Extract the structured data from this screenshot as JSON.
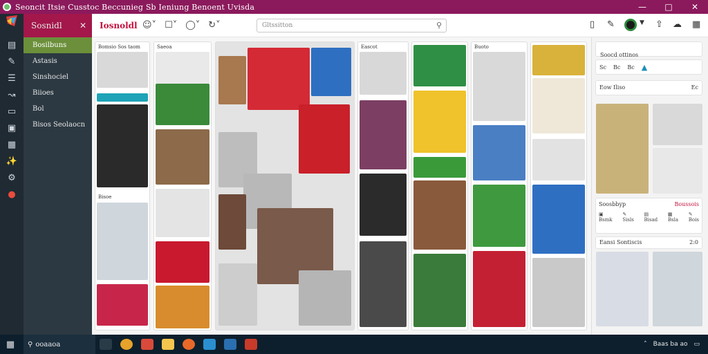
{
  "window": {
    "title": "Seoncit Itsie Cusstoc Beccunieg  Sb  Ieniung Benoent  Uvisda",
    "minimize_icon": "minimize-icon",
    "maximize_icon": "maximize-icon",
    "close_icon": "close-icon"
  },
  "sidebar": {
    "header_label": "Sosnidl",
    "items": [
      {
        "label": "Bosilbuns"
      },
      {
        "label": "Astasis"
      },
      {
        "label": "Sinshociel"
      },
      {
        "label": "Biioes"
      },
      {
        "label": "Bol"
      },
      {
        "label": "Bisos Seolaocn"
      }
    ]
  },
  "toolbar": {
    "brand": "Iosnoldl",
    "search_placeholder": "Gltssitton"
  },
  "gallery": {
    "captions": [
      "Bomsio Sos taom",
      "Saeoa",
      "Eascot",
      "Buoto",
      "Bisoe"
    ]
  },
  "right_panel": {
    "section1_title": "Soocd ottinos",
    "filter_labels": [
      "Sc",
      "Bc",
      "Bc"
    ],
    "section2_title": "Eow Iliso",
    "section2_count": "Ec",
    "section3_title": "Soosbbyp",
    "section3_link": "Boussois",
    "tool_labels": [
      "Bsmk",
      "Sisls",
      "Bisad",
      "Bsla",
      "Bois"
    ],
    "section4_title": "Eansi Sontiscis",
    "section4_count": "2:0"
  },
  "taskbar": {
    "search_text": "ooaaoa",
    "tray_text": "Baas ba ao"
  },
  "colors": {
    "title_bar": "#8b1a5c",
    "sidebar_header": "#a3174a",
    "sidebar_active": "#6b8f3a",
    "sidebar_bg": "#2c3942",
    "taskbar": "#0d1f2d",
    "brand": "#c4123e"
  }
}
